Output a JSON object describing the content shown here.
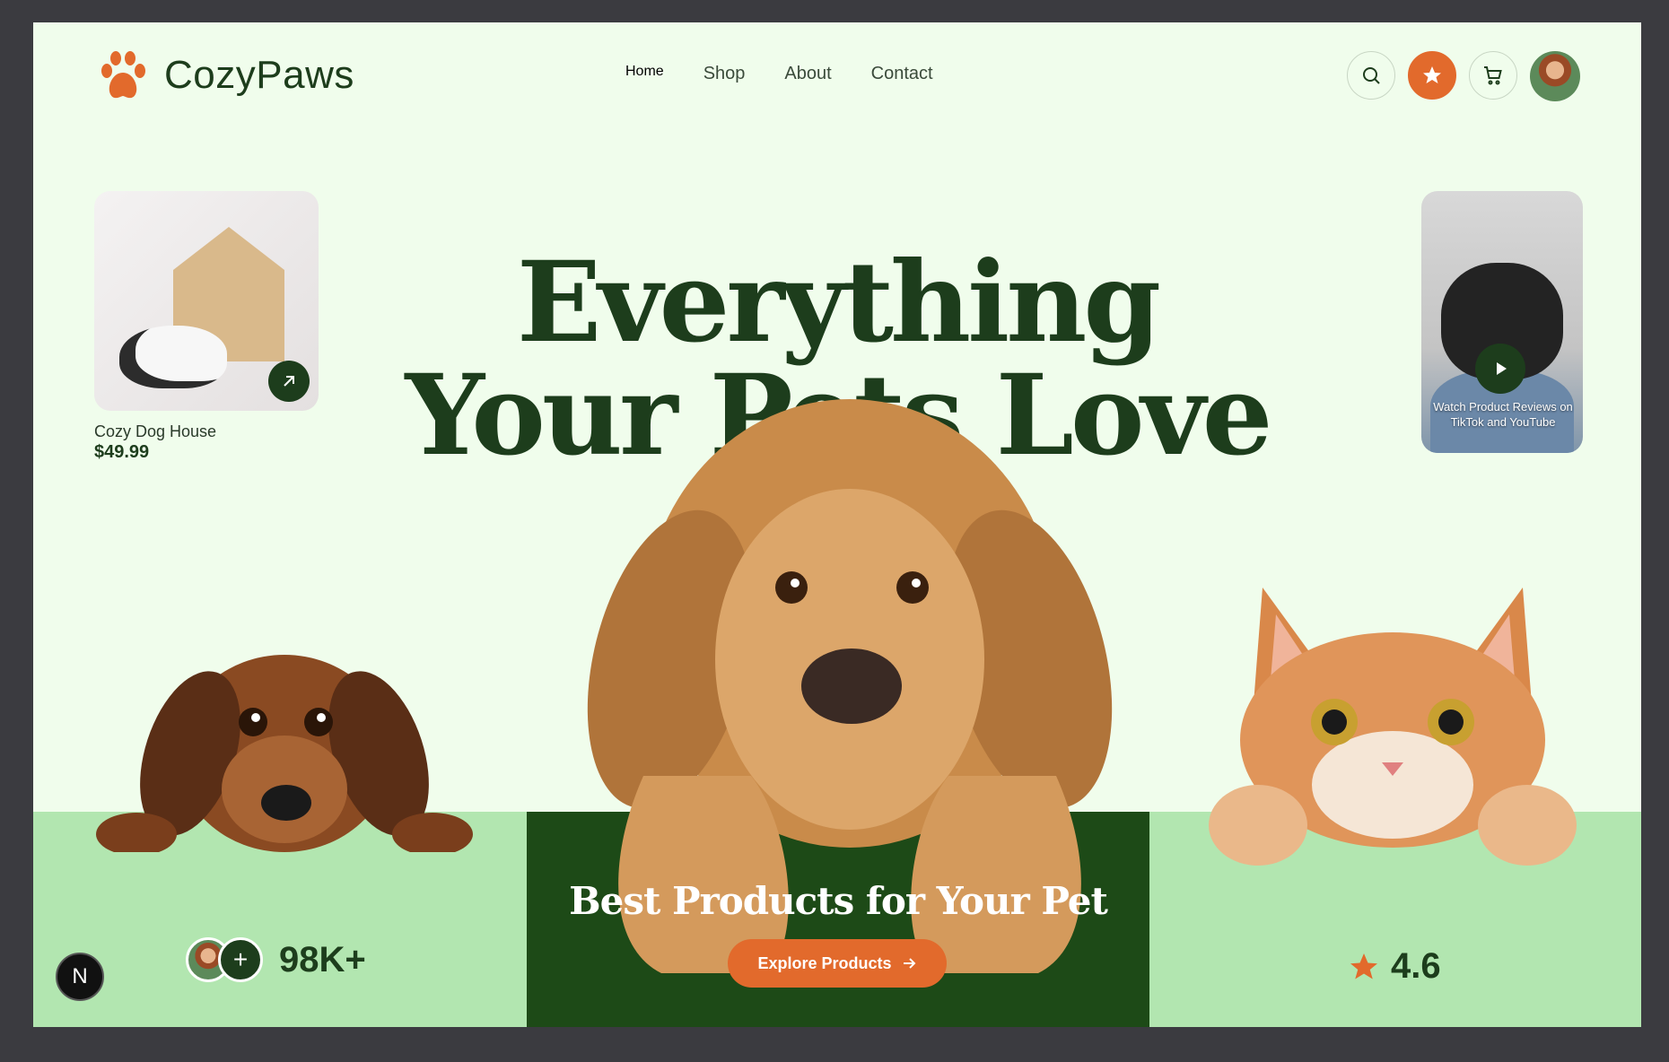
{
  "brand": {
    "name": "CozyPaws",
    "accent": "#e26a2c",
    "dark_green": "#1d3d1c",
    "light_green": "#b2e6b0",
    "bg": "#f0fdec"
  },
  "nav": {
    "items": [
      {
        "label": "Home",
        "active": true
      },
      {
        "label": "Shop",
        "active": false
      },
      {
        "label": "About",
        "active": false
      },
      {
        "label": "Contact",
        "active": false
      }
    ]
  },
  "header_icons": [
    "search-icon",
    "star-icon",
    "cart-icon",
    "user-avatar"
  ],
  "product_card": {
    "name": "Cozy Dog House",
    "price": "$49.99"
  },
  "video_card": {
    "caption": "Watch Product Reviews on TikTok and YouTube"
  },
  "hero": {
    "line1": "Everything",
    "line2": "Your Pets Love"
  },
  "cta": {
    "title": "Best Products for Your Pet",
    "button_label": "Explore Products"
  },
  "stats": {
    "customers": "98K+",
    "rating": "4.6"
  },
  "corner_badge": "N"
}
